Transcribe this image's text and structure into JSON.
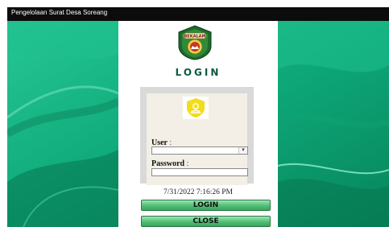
{
  "window": {
    "title": "Pengelolaan Surat Desa Soreang"
  },
  "logo": {
    "banner_text": "BEKALAM"
  },
  "heading": "LOGIN",
  "form": {
    "user_label": "User",
    "user_colon": ":",
    "user_value": "",
    "password_label": "Password",
    "password_colon": ":",
    "password_value": ""
  },
  "datetime": "7/31/2022 7:16:26 PM",
  "buttons": {
    "login": "LOGIN",
    "close": "CLOSE"
  },
  "colors": {
    "titlebar": "#0c0c0c",
    "background_green": "#0aa777",
    "heading": "#0e5a3f",
    "button_green": "#4fbf74",
    "user_icon_yellow": "#f3dc1a"
  },
  "icons": {
    "dropdown": "chevron-down-icon",
    "user": "user-icon",
    "logo": "emblem-logo"
  }
}
